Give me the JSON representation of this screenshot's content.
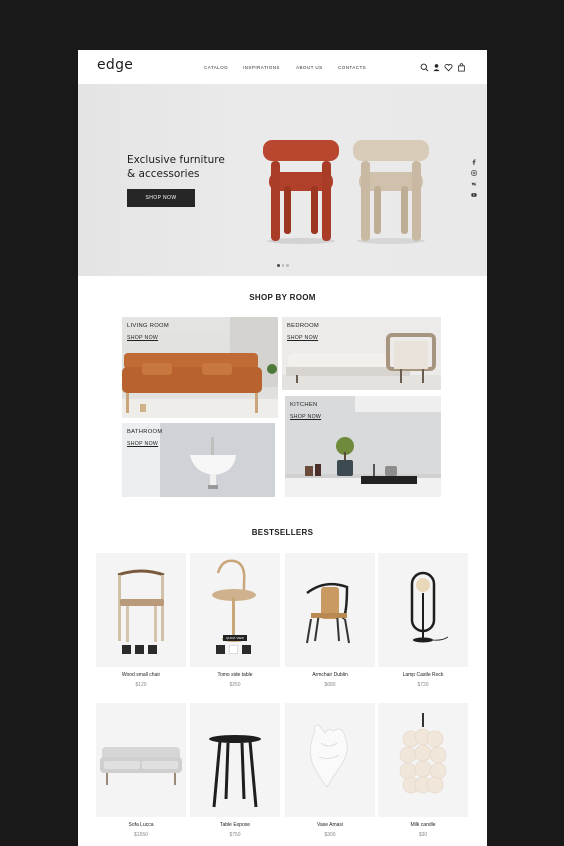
{
  "brand": "edge",
  "nav": {
    "catalog": "CATALOG",
    "inspirations": "INSPIRATIONS",
    "about": "ABOUT US",
    "contacts": "CONTACTS"
  },
  "header_icons": [
    "search-icon",
    "user-icon",
    "heart-icon",
    "bag-icon"
  ],
  "hero": {
    "title": "Exclusive furniture\n& accessories",
    "button": "SHOP NOW",
    "slides": 3,
    "active_slide": 1,
    "social": [
      "facebook-icon",
      "instagram-icon",
      "vk-icon",
      "youtube-icon"
    ]
  },
  "shop_by_room": {
    "title": "SHOP BY ROOM",
    "rooms": [
      {
        "label": "LIVING ROOM",
        "link": "SHOP NOW"
      },
      {
        "label": "BEDROOM",
        "link": "SHOP NOW"
      },
      {
        "label": "BATHROOM",
        "link": "SHOP NOW"
      },
      {
        "label": "KITCHEN",
        "link": "SHOP NOW"
      }
    ]
  },
  "bestsellers": {
    "title": "BESTSELLERS",
    "quick_view": "QUICK VIEW",
    "products": [
      {
        "name": "Wood small chair",
        "price": "$120"
      },
      {
        "name": "Tomo side table",
        "price": "$250"
      },
      {
        "name": "Armchair Dublin",
        "price": "$680"
      },
      {
        "name": "Lamp Castle Rock",
        "price": "$720"
      },
      {
        "name": "Sofa Lucca",
        "price": "$1550"
      },
      {
        "name": "Table Expose",
        "price": "$750"
      },
      {
        "name": "Vase Amasi",
        "price": "$300"
      },
      {
        "name": "Milk candle",
        "price": "$30"
      }
    ]
  },
  "colors": {
    "background": "#191919",
    "page": "#ffffff",
    "button": "#262626",
    "chair_red": "#b9472f",
    "chair_beige": "#d8cbb8"
  }
}
